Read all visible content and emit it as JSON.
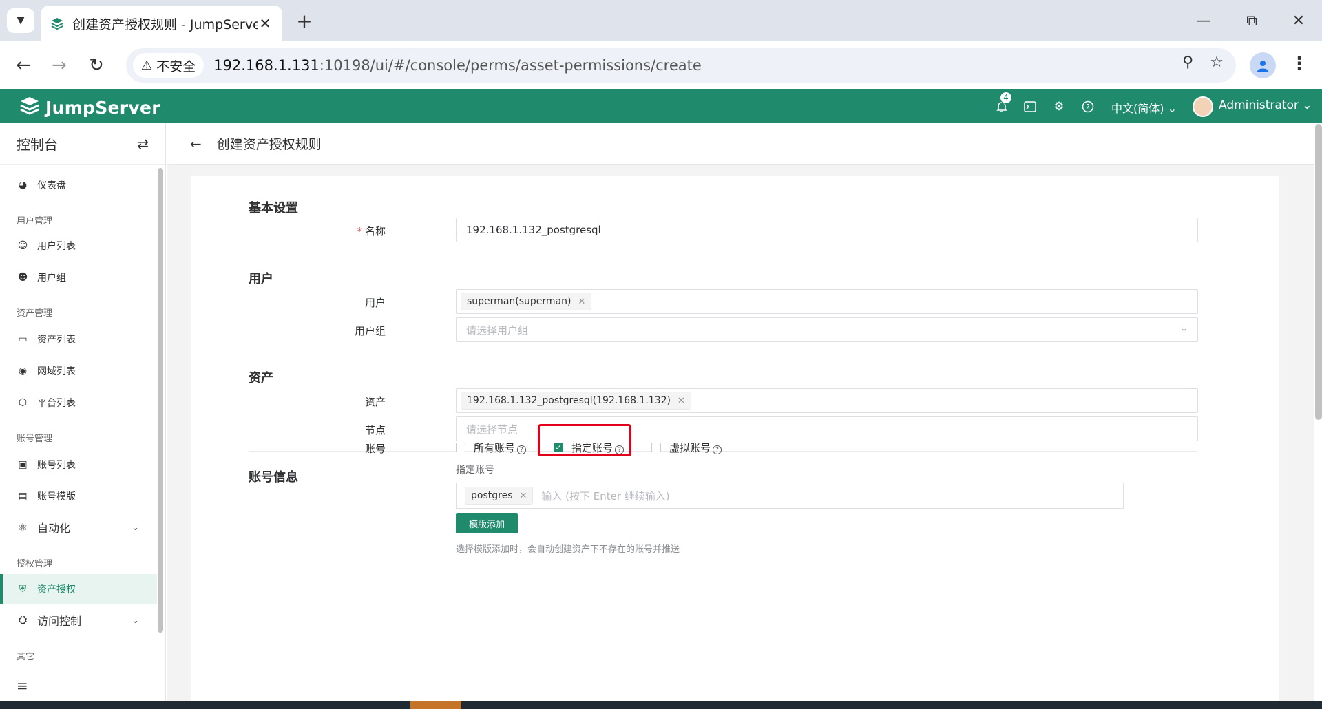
{
  "browser": {
    "tab_title": "创建资产授权规则 - JumpServer",
    "security_label": "不安全",
    "url_host": "192.168.1.131",
    "url_rest": ":10198/ui/#/console/perms/asset-permissions/create"
  },
  "header": {
    "logo_text": "JumpServer",
    "notification_count": "4",
    "language": "中文(简体)",
    "user_name": "Administrator"
  },
  "sidebar": {
    "title": "控制台",
    "dashboard": "仪表盘",
    "groups": {
      "users": "用户管理",
      "assets": "资产管理",
      "accounts": "账号管理",
      "perms": "授权管理",
      "other": "其它"
    },
    "items": {
      "user_list": "用户列表",
      "user_group": "用户组",
      "asset_list": "资产列表",
      "domain_list": "网域列表",
      "platform_list": "平台列表",
      "account_list": "账号列表",
      "account_template": "账号模版",
      "automation": "自动化",
      "asset_perm": "资产授权",
      "access_control": "访问控制"
    }
  },
  "page": {
    "title": "创建资产授权规则"
  },
  "form": {
    "basic": {
      "section": "基本设置",
      "name_label": "名称",
      "name_value": "192.168.1.132_postgresql"
    },
    "user": {
      "section": "用户",
      "user_label": "用户",
      "user_tag": "superman(superman)",
      "group_label": "用户组",
      "group_placeholder": "请选择用户组"
    },
    "asset": {
      "section": "资产",
      "asset_label": "资产",
      "asset_tag": "192.168.1.132_postgresql(192.168.1.132)",
      "node_label": "节点",
      "node_placeholder": "请选择节点"
    },
    "account": {
      "section": "账号信息",
      "account_label": "账号",
      "opt_all": "所有账号",
      "opt_specified": "指定账号",
      "opt_virtual": "虚拟账号",
      "specified_label": "指定账号",
      "account_tag": "postgres",
      "input_placeholder": "输入 (按下 Enter 继续输入)",
      "template_button": "模版添加",
      "hint": "选择模版添加时，会自动创建资产下不存在的账号并推送"
    }
  },
  "colors": {
    "brand": "#1f8a6c",
    "highlight": "#e3001b"
  }
}
